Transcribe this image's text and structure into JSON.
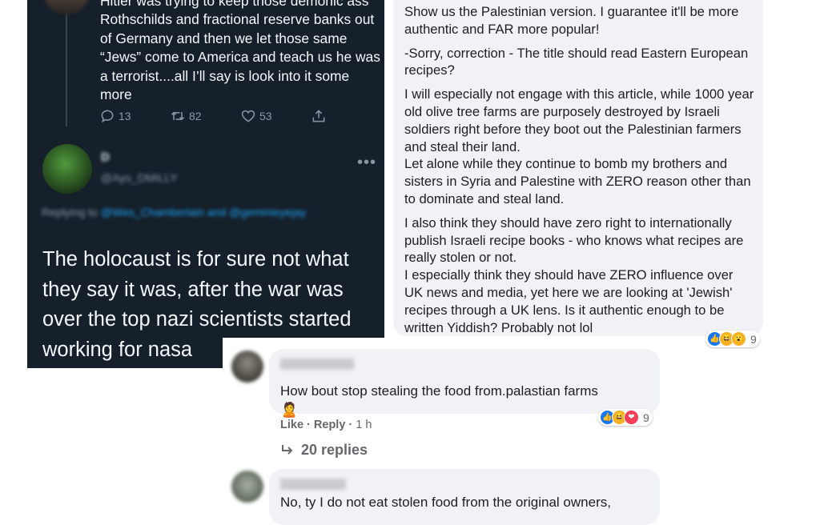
{
  "fb_top_comment": {
    "paragraphs": [
      "Show us the Palestinian version. I guarantee it'll be more authentic and FAR more popular!",
      "-Sorry, correction - The title should read Eastern European recipes?",
      "I will especially not engage with this article, while 1000 year old olive tree farms are purposely destroyed by Israeli soldiers right before they boot out the Palestinian farmers and steal their land.",
      "Let alone while they continue to bomb my brothers and sisters in Syria and Palestine with ZERO reason other than to dominate and steal land.",
      "I also think they should have zero right to internationally publish Israeli recipe books - who knows what recipes are really stolen or not.",
      "I especially think they should have ZERO influence over UK news and media, yet here we are looking at 'Jewish' recipes through a UK lens. Is it authentic enough to be written Yiddish? Probably not lol"
    ],
    "reaction_count": "9"
  },
  "tweet_top": {
    "text": "Hitler was trying to keep those demonic ass Rothschilds and fractional reserve banks out of Germany and then we let those same “Jews” come to America and teach us he was a terrorist....all I’ll say is look into it some more",
    "replies": "13",
    "retweets": "82",
    "likes": "53"
  },
  "tweet_reply": {
    "display_name": "D",
    "handle": "@Ayo_DMILLY",
    "replying_prefix": "Replying to",
    "replying_to": "@Wes_Chamberlain and @geminieyejay",
    "text": "The holocaust is for sure not what they say it was, after the war was over the top nazi scientists started working for nasa"
  },
  "fb_bottom": {
    "comment1": {
      "text": "How bout stop stealing the food from.palastian farms",
      "emoji": "🙎",
      "like": "Like",
      "reply": "Reply",
      "time": "1 h",
      "reaction_count": "9",
      "replies_label": "20 replies"
    },
    "comment2": {
      "text": "No, ty I do not eat stolen food from the original owners,"
    }
  }
}
